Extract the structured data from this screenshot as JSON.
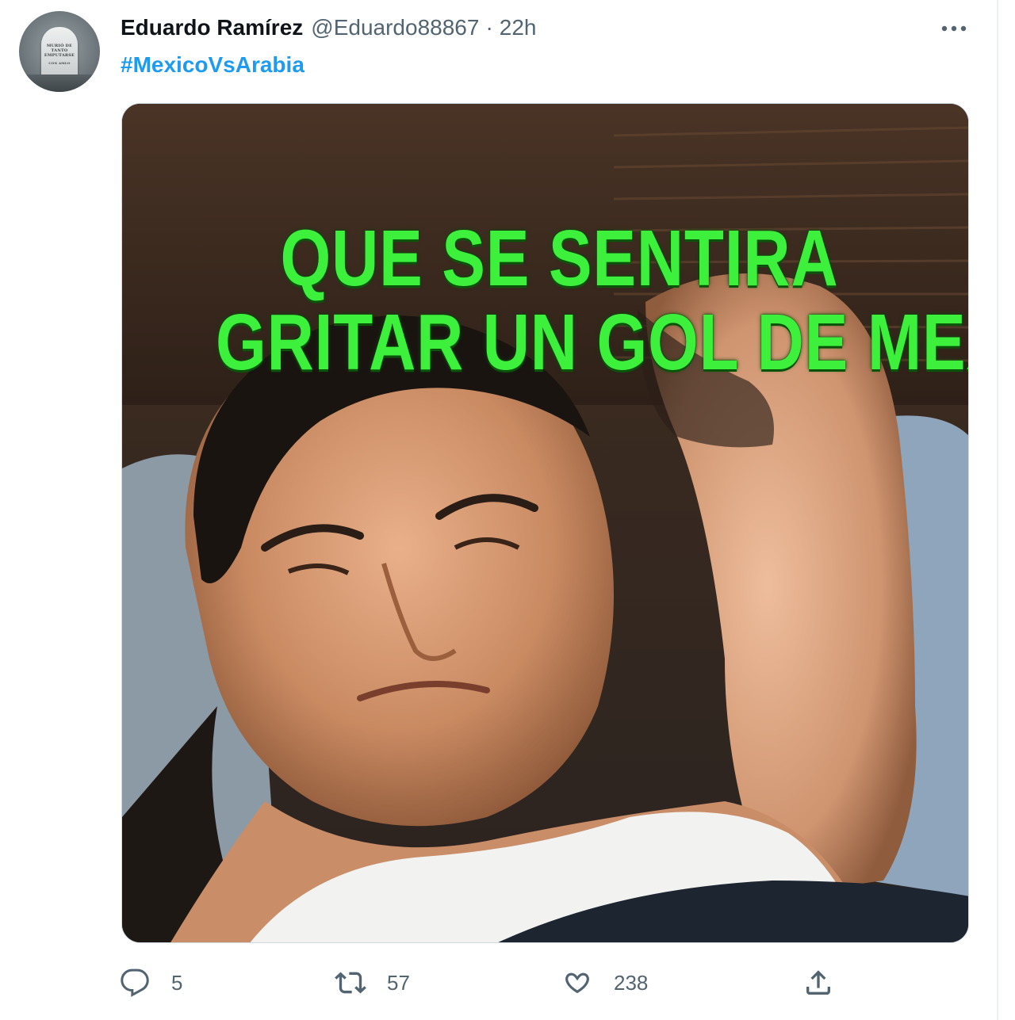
{
  "tweet": {
    "author": {
      "display_name": "Eduardo Ramírez",
      "handle": "@Eduardo88867",
      "separator": "·",
      "time": "22h",
      "avatar_text": [
        "MURIÓ DE",
        "TANTO",
        "EMPUTARSE",
        "CON AMLO"
      ]
    },
    "text": "#MexicoVsArabia",
    "media": {
      "meme_line_1": "QUE SE SENTIRA",
      "meme_line_2": "GRITAR UN GOL DE MEXICO"
    },
    "actions": {
      "reply_count": "5",
      "retweet_count": "57",
      "like_count": "238"
    }
  },
  "icons": {
    "more": "more-horizontal-icon",
    "reply": "reply-icon",
    "retweet": "retweet-icon",
    "like": "heart-icon",
    "share": "share-icon"
  },
  "colors": {
    "link": "#1d9bf0",
    "muted": "#536471",
    "text": "#0f1419",
    "meme_green": "#3cf03c"
  }
}
